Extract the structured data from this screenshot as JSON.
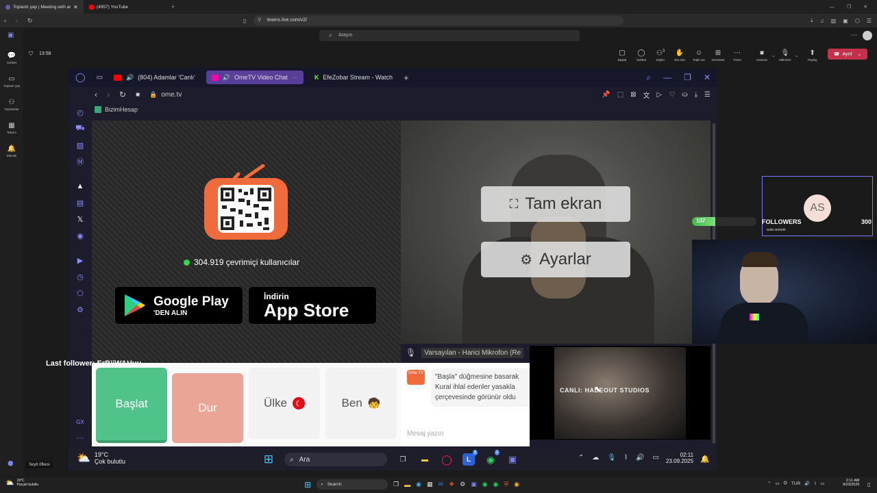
{
  "outer_browser": {
    "tabs": [
      {
        "label": "Toplantı yap | Meeting with ar",
        "active": true
      },
      {
        "label": "(4957) YouTube",
        "active": false
      }
    ],
    "url": "teams.live.com/v2/"
  },
  "teams": {
    "search_placeholder": "Arayın",
    "rail": [
      {
        "label": "Sohbet",
        "icon": "chat-icon"
      },
      {
        "label": "Toplantı yap",
        "icon": "camera-icon"
      },
      {
        "label": "Topluluklar",
        "icon": "communities-icon"
      },
      {
        "label": "Takvim",
        "icon": "calendar-icon"
      },
      {
        "label": "Etkinlik",
        "icon": "bell-icon"
      }
    ],
    "meeting_time": "13:58",
    "toolbar": [
      {
        "label": "Başlat",
        "icon": "whiteboard-icon"
      },
      {
        "label": "Sohbet",
        "icon": "chat-icon"
      },
      {
        "label": "Kişiler",
        "icon": "people-icon"
      },
      {
        "label": "Söz iste",
        "icon": "hand-icon"
      },
      {
        "label": "Tepki ver",
        "icon": "emoji-icon"
      },
      {
        "label": "Görünüm",
        "icon": "grid-icon"
      },
      {
        "label": "Tümü",
        "icon": "more-icon"
      },
      {
        "label": "Kamera",
        "icon": "video-off-icon"
      },
      {
        "label": "Mikrofon",
        "icon": "mic-icon"
      },
      {
        "label": "Paylaş",
        "icon": "share-icon"
      }
    ],
    "people_count": "3",
    "leave_label": "Ayrıl",
    "user_label": "Seyit öfkesi"
  },
  "opera": {
    "tabs": [
      {
        "label": "(804) Adamlar 'Canlı'",
        "active": false
      },
      {
        "label": "OmeTV Video Chat",
        "active": true
      },
      {
        "label": "EfeZobar Stream - Watch",
        "active": false
      }
    ],
    "url": "ome.tv",
    "bookmark": "BizimHesap",
    "sidebar_bottom": "GX"
  },
  "ometv": {
    "online_count": "304.919 çevrimiçi kullanıcılar",
    "google_play": {
      "line1": "Google Play",
      "line2": "'DEN ALIN"
    },
    "app_store": {
      "line1": "İndirin",
      "line2": "App Store"
    },
    "overlay_fullscreen": "Tam ekran",
    "overlay_settings": "Ayarlar",
    "mic_label": "Varsayılan - Harici Mikrofon (Re",
    "controls": {
      "start": "Başlat",
      "stop": "Dur",
      "country": "Ülke",
      "me": "Ben"
    },
    "chat_message_lines": [
      "\"Başla\" düğmesine basarak",
      "Kural ihlal edenler yasakla",
      "çerçevesinde görünür oldu"
    ],
    "chat_placeholder": "Mesaj yazın",
    "logo_text": "Ome TV"
  },
  "stream_box": {
    "text": "CANLI: HADEOUT STUDIOS"
  },
  "stream_overlay": {
    "avatar_initials": "AS",
    "followers_label": "FOLLOWERS",
    "followers_current": "107",
    "followers_goal": "300",
    "followers_progress": 0.36,
    "latest_follower": "arda senturk",
    "last_follower_text": "Last follower: ErBijWAHuu"
  },
  "inner_taskbar": {
    "weather_temp": "19°C",
    "weather_desc": "Çok bulutlu",
    "search_label": "Ara",
    "time": "02:11",
    "date": "23.09.2025",
    "badge_1": "1",
    "badge_2": "2"
  },
  "outer_taskbar": {
    "weather_temp": "19°C",
    "weather_desc": "Parçalı bulutlu",
    "search_label": "Search",
    "lang": "TUR",
    "time": "2:11 AM",
    "date": "9/23/2025"
  },
  "colors": {
    "start": "#4fc38a",
    "stop": "#eba596",
    "teams_leave": "#c4314b",
    "opera_accent": "#5a3f9a"
  }
}
